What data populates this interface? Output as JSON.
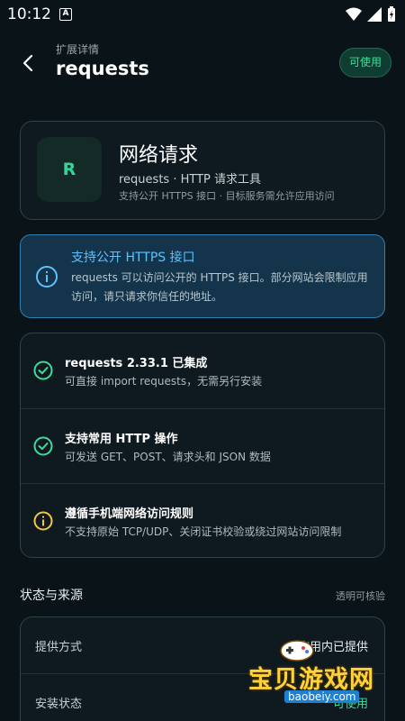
{
  "status_bar": {
    "time": "10:12",
    "notif_letter": "A"
  },
  "header": {
    "subtitle": "扩展详情",
    "title": "requests",
    "badge": "可使用"
  },
  "app": {
    "icon_letter": "R",
    "name": "网络请求",
    "subtitle": "requests · HTTP 请求工具",
    "description": "支持公开 HTTPS 接口 · 目标服务需允许应用访问"
  },
  "info": {
    "title": "支持公开 HTTPS 接口",
    "text": "requests 可以访问公开的 HTTPS 接口。部分网站会限制应用访问，请只请求你信任的地址。"
  },
  "features": [
    {
      "icon": "check-circle-icon",
      "title": "requests 2.33.1 已集成",
      "desc": "可直接 import requests，无需另行安装"
    },
    {
      "icon": "check-circle-icon",
      "title": "支持常用 HTTP 操作",
      "desc": "可发送 GET、POST、请求头和 JSON 数据"
    },
    {
      "icon": "info-circle-icon",
      "title": "遵循手机端网络访问规则",
      "desc": "不支持原始 TCP/UDP、关闭证书校验或绕过网站访问限制"
    }
  ],
  "section": {
    "title": "状态与来源",
    "note": "透明可核验"
  },
  "status_rows": [
    {
      "label": "提供方式",
      "value": "应用内已提供"
    },
    {
      "label": "安装状态",
      "value": "可使用"
    }
  ],
  "watermark": {
    "text": "宝贝游戏网",
    "url": "baobeiy.com"
  },
  "colors": {
    "accent_green": "#3ddc9e",
    "info_blue": "#5cc2ff",
    "warning_yellow": "#f5c542",
    "background": "#0a1318"
  }
}
